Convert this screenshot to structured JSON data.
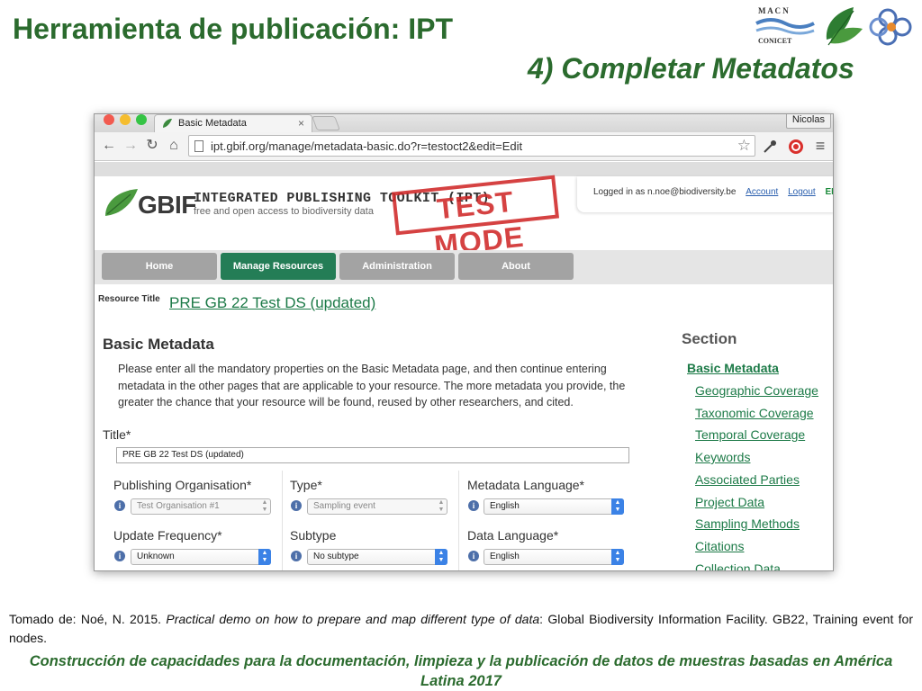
{
  "slide": {
    "title": "Herramienta de publicación: IPT",
    "subtitle": "4) Completar Metadatos",
    "logos": {
      "macn_top": "M A C N",
      "macn_bottom": "CONICET"
    },
    "citation_prefix": "Tomado de: Noé, N. 2015.",
    "citation_italic": "Practical demo on how to prepare and map different type of data",
    "citation_suffix": ": Global Biodiversity Information Facility. GB22, Training event  for nodes.",
    "footer": "Construcción de capacidades para la documentación, limpieza y la publicación de datos de muestras basadas en América Latina 2017"
  },
  "browser": {
    "tab_title": "Basic Metadata",
    "tab_close": "×",
    "profile_name": "Nicolas",
    "url": "ipt.gbif.org/manage/metadata-basic.do?r=testoct2&edit=Edit",
    "nav": {
      "back": "←",
      "forward": "→",
      "reload": "↻",
      "home": "⌂",
      "star": "☆",
      "menu": "≡"
    }
  },
  "ipt": {
    "brand": "GBIF",
    "product_name": "INTEGRATED PUBLISHING TOOLKIT (IPT)",
    "tagline": "free and open access to biodiversity data",
    "test_mode": "TEST MODE",
    "logged_in": "Logged in as n.noe@biodiversity.be",
    "account_link": "Account",
    "logout_link": "Logout",
    "language": "ENGL",
    "nav_tabs": [
      {
        "label": "Home"
      },
      {
        "label": "Manage Resources"
      },
      {
        "label": "Administration"
      },
      {
        "label": "About"
      }
    ],
    "resource_title_label": "Resource Title",
    "resource_title": "PRE GB 22 Test DS (updated)",
    "page_heading": "Basic Metadata",
    "intro": "Please enter all the mandatory properties on the Basic Metadata page, and then continue entering metadata in the other pages that are applicable to your resource. The more metadata you provide, the greater the chance that your resource will be found, reused by other researchers, and cited.",
    "title_field": {
      "label": "Title*",
      "value": "PRE GB 22 Test DS (updated)"
    },
    "fields": [
      {
        "label": "Publishing Organisation*",
        "value": "Test Organisation #1"
      },
      {
        "label": "Type*",
        "value": "Sampling event"
      },
      {
        "label": "Metadata Language*",
        "value": "English"
      },
      {
        "label": "Update Frequency*",
        "value": "Unknown"
      },
      {
        "label": "Subtype",
        "value": "No subtype"
      },
      {
        "label": "Data Language*",
        "value": "English"
      }
    ],
    "info_glyph": "i",
    "section_heading": "Section",
    "sections": [
      "Basic Metadata",
      "Geographic Coverage",
      "Taxonomic Coverage",
      "Temporal Coverage",
      "Keywords",
      "Associated Parties",
      "Project Data",
      "Sampling Methods",
      "Citations",
      "Collection Data"
    ]
  },
  "colors": {
    "slide_green": "#2b6b2e",
    "ipt_green": "#247d56",
    "link_green": "#1c7a47",
    "test_red": "#d02828"
  }
}
